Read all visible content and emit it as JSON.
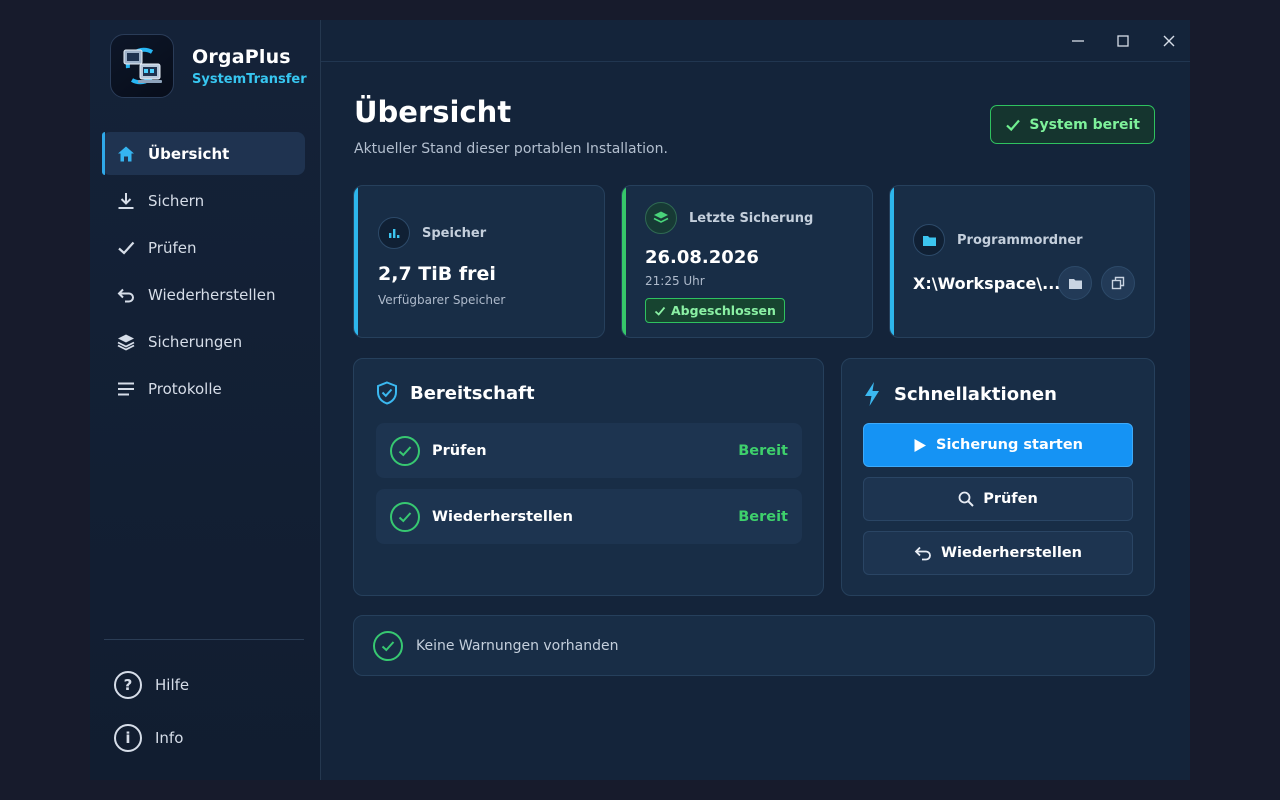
{
  "app": {
    "name": "OrgaPlus",
    "subtitle": "SystemTransfer"
  },
  "nav": {
    "items": [
      {
        "label": "Übersicht",
        "icon": "home-icon",
        "active": true
      },
      {
        "label": "Sichern",
        "icon": "download-icon"
      },
      {
        "label": "Prüfen",
        "icon": "check-icon"
      },
      {
        "label": "Wiederherstellen",
        "icon": "undo-icon"
      },
      {
        "label": "Sicherungen",
        "icon": "layers-icon"
      },
      {
        "label": "Protokolle",
        "icon": "list-icon"
      }
    ],
    "help_label": "Hilfe",
    "info_label": "Info"
  },
  "header": {
    "title": "Übersicht",
    "subtitle": "Aktueller Stand dieser portablen Installation.",
    "status": "System bereit"
  },
  "cards": {
    "storage": {
      "label": "Speicher",
      "value": "2,7 TiB frei",
      "caption": "Verfügbarer Speicher"
    },
    "last_backup": {
      "label": "Letzte Sicherung",
      "date": "26.08.2026",
      "time": "21:25 Uhr",
      "badge": "Abgeschlossen"
    },
    "program_folder": {
      "label": "Programmordner",
      "path": "X:\\Workspace\\..."
    }
  },
  "readiness": {
    "title": "Bereitschaft",
    "rows": [
      {
        "label": "Prüfen",
        "status": "Bereit"
      },
      {
        "label": "Wiederherstellen",
        "status": "Bereit"
      }
    ]
  },
  "quick_actions": {
    "title": "Schnellaktionen",
    "start_backup": "Sicherung starten",
    "verify": "Prüfen",
    "restore": "Wiederherstellen"
  },
  "warnings": {
    "text": "Keine Warnungen vorhanden"
  },
  "colors": {
    "accent": "#2fa8e8",
    "success": "#37c871",
    "primary_button": "#1593f4",
    "background": "#14243a"
  }
}
